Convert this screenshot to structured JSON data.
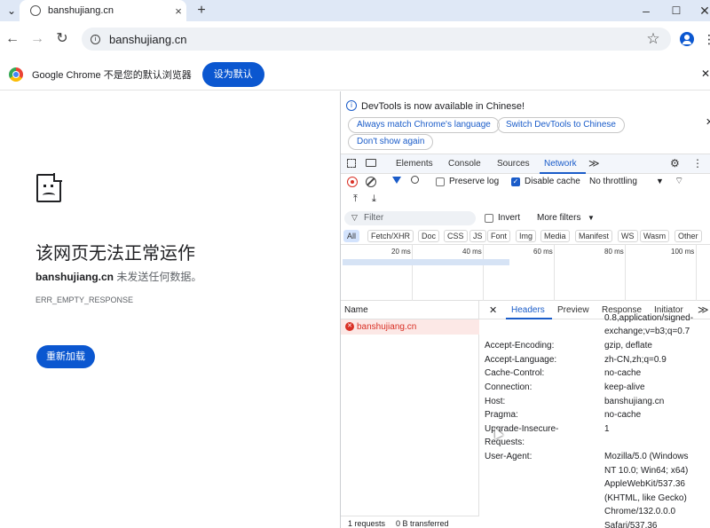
{
  "tab": {
    "title": "banshujiang.cn",
    "new_tab": "+"
  },
  "window": {
    "minimize": "–",
    "maximize": "☐",
    "close": "✕",
    "tab_search": "⌄"
  },
  "toolbar": {
    "back": "←",
    "forward": "→",
    "reload": "↻",
    "url": "banshujiang.cn",
    "star": "☆"
  },
  "infobar": {
    "message": "Google Chrome 不是您的默认浏览器",
    "button": "设为默认",
    "close": "✕"
  },
  "error": {
    "title": "该网页无法正常运作",
    "host": "banshujiang.cn",
    "desc": " 未发送任何数据。",
    "code": "ERR_EMPTY_RESPONSE",
    "reload": "重新加载"
  },
  "devtools": {
    "banner": {
      "text": "DevTools is now available in Chinese!",
      "btn1": "Always match Chrome's language",
      "btn2": "Switch DevTools to Chinese",
      "btn3": "Don't show again",
      "close": "✕"
    },
    "tabs": [
      "Elements",
      "Console",
      "Sources",
      "Network"
    ],
    "more": "≫",
    "network_toolbar": {
      "preserve_log": "Preserve log",
      "disable_cache": "Disable cache",
      "throttling": "No throttling"
    },
    "filter": {
      "placeholder": "Filter",
      "invert": "Invert",
      "more_filters": "More filters"
    },
    "types": [
      "All",
      "Fetch/XHR",
      "Doc",
      "CSS",
      "JS",
      "Font",
      "Img",
      "Media",
      "Manifest",
      "WS",
      "Wasm",
      "Other"
    ],
    "timeline": [
      "20 ms",
      "40 ms",
      "60 ms",
      "80 ms",
      "100 ms"
    ],
    "name_header": "Name",
    "request": "banshujiang.cn",
    "detail_tabs": [
      "Headers",
      "Preview",
      "Response",
      "Initiator"
    ],
    "headers_partial": [
      "0.8,application/signed-",
      "exchange;v=b3;q=0.7"
    ],
    "headers": [
      {
        "k": "Accept-Encoding:",
        "v": "gzip, deflate"
      },
      {
        "k": "Accept-Language:",
        "v": "zh-CN,zh;q=0.9"
      },
      {
        "k": "Cache-Control:",
        "v": "no-cache"
      },
      {
        "k": "Connection:",
        "v": "keep-alive"
      },
      {
        "k": "Host:",
        "v": "banshujiang.cn"
      },
      {
        "k": "Pragma:",
        "v": "no-cache"
      },
      {
        "k": "Upgrade-Insecure-",
        "v": "1"
      },
      {
        "k": "Requests:",
        "v": ""
      },
      {
        "k": "User-Agent:",
        "v": "Mozilla/5.0 (Windows"
      }
    ],
    "ua_cont": [
      "NT 10.0; Win64; x64)",
      "AppleWebKit/537.36",
      "(KHTML, like Gecko)",
      "Chrome/132.0.0.0",
      "Safari/537.36"
    ],
    "status": {
      "requests": "1 requests",
      "transferred": "0 B transferred"
    }
  },
  "colors": {
    "accent": "#0b57d0",
    "tabstrip": "#dfe8f6",
    "error": "#d93025",
    "selected_row": "#fce8e6"
  }
}
